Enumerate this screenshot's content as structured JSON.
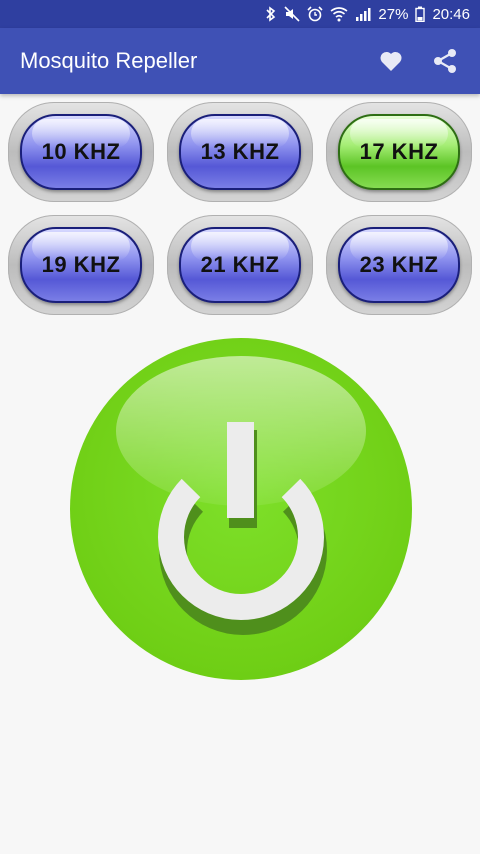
{
  "status_bar": {
    "battery": "27%",
    "time": "20:46",
    "icons": [
      "bluetooth-icon",
      "mute-icon",
      "alarm-icon",
      "wifi-icon",
      "signal-icon",
      "battery-icon"
    ]
  },
  "app_bar": {
    "title": "Mosquito Repeller",
    "actions": [
      "heart-icon",
      "share-icon"
    ]
  },
  "frequencies": [
    {
      "label": "10 KHZ",
      "selected": false
    },
    {
      "label": "13 KHZ",
      "selected": false
    },
    {
      "label": "17 KHZ",
      "selected": true
    },
    {
      "label": "19 KHZ",
      "selected": false
    },
    {
      "label": "21 KHZ",
      "selected": false
    },
    {
      "label": "23 KHZ",
      "selected": false
    }
  ],
  "power_button": {
    "icon": "power-icon",
    "state": "on"
  },
  "colors": {
    "status_bar": "#2f3fa0",
    "app_bar": "#3f51b5",
    "freq_blue": "#6a6ee0",
    "freq_selected_green": "#6ed43a",
    "power_green": "#72d118"
  }
}
